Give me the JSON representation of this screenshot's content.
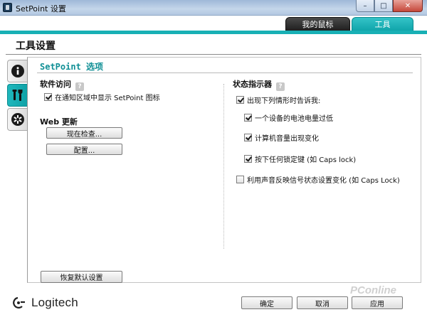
{
  "window": {
    "title": "SetPoint 设置",
    "min_glyph": "–",
    "max_glyph": "□",
    "close_glyph": "✕"
  },
  "top_tabs": [
    {
      "label": "我的鼠标",
      "active": false
    },
    {
      "label": "工具",
      "active": true
    }
  ],
  "page_title": "工具设置",
  "side_tabs": [
    {
      "icon": "info-icon",
      "active": false
    },
    {
      "icon": "tools-icon",
      "active": true
    },
    {
      "icon": "settings-gear-icon",
      "active": false
    }
  ],
  "section_title": "SetPoint 选项",
  "software_access": {
    "title": "软件访问",
    "help": "?",
    "show_tray_icon": {
      "label": "在通知区域中显示 SetPoint 图标",
      "checked": true
    }
  },
  "web_update": {
    "title": "Web 更新",
    "check_now_label": "现在检查...",
    "configure_label": "配置..."
  },
  "status_indicator": {
    "title": "状态指示器",
    "help": "?",
    "notify_me": {
      "label": "出现下列情形时告诉我:",
      "checked": true
    },
    "low_battery": {
      "label": "一个设备的电池电量过低",
      "checked": true
    },
    "volume_change": {
      "label": "计算机音量出现变化",
      "checked": true
    },
    "lock_key": {
      "label": "按下任何锁定键 (如 Caps lock)",
      "checked": true
    },
    "sound_feedback": {
      "label": "利用声音反映信号状态设置变化 (如 Caps Lock)",
      "checked": false
    }
  },
  "restore_defaults_label": "恢复默认设置",
  "footer": {
    "brand": "Logitech",
    "ok_label": "确定",
    "cancel_label": "取消",
    "apply_label": "应用",
    "watermark": "PConline"
  },
  "colors": {
    "accent": "#18b0b5",
    "tab_dark": "#1f1f1f"
  }
}
